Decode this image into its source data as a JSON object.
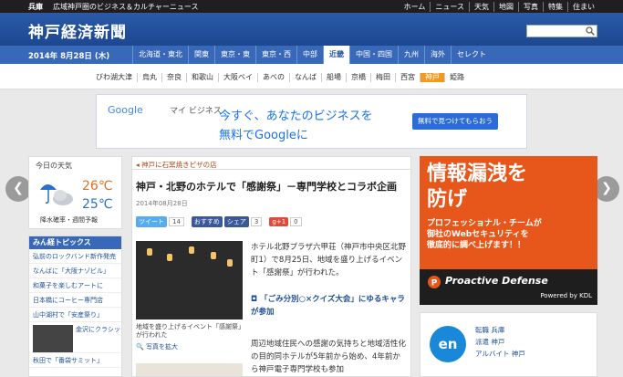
{
  "topbar": {
    "tag": "兵庫",
    "subtitle": "広域神戸圏のビジネス＆カルチャーニュース",
    "nav": [
      "ホーム",
      "ニュース",
      "天気",
      "地図",
      "写真",
      "特集",
      "住まい"
    ]
  },
  "header": {
    "logo": "神戸経済新聞",
    "search_placeholder": ""
  },
  "regionbar": {
    "date": "2014年 8月28日",
    "weekday": "(木)",
    "regions": [
      "北海道・東北",
      "関東",
      "東京・東",
      "東京・西",
      "中部",
      "近畿",
      "中国・四国",
      "九州",
      "海外",
      "セレクト"
    ],
    "active": "近畿"
  },
  "subnav": {
    "items": [
      "びわ湖大津",
      "烏丸",
      "奈良",
      "和歌山",
      "大阪ベイ",
      "あべの",
      "なんば",
      "船場",
      "京橋",
      "梅田",
      "西宮",
      "神戸",
      "姫路"
    ],
    "active": "神戸"
  },
  "ad": {
    "google": "Google",
    "mybusiness": "マイ ビジネス",
    "line1": "今すぐ、あなたのビジネスを",
    "line2": "無料でGoogleに",
    "cta": "無料で見つけてもらおう"
  },
  "weather": {
    "title": "今日の天気",
    "high": "26℃",
    "low": "25℃",
    "note": "降水確率・週間予報"
  },
  "topics": {
    "title": "みん経トピックス",
    "items": [
      "弘前のロックバンド新作発売",
      "なんばに「大阪ナゾビル」",
      "和菓子を楽しむアートに",
      "日本橋にコーヒー専門店",
      "山中湖村で「安産祭り」",
      "金沢にクラシックのカフェ",
      "秋田で「番袋サミット」"
    ]
  },
  "article": {
    "crumb": "神戸に石窯焼きピザの店",
    "title": "神戸・北野のホテルで「感謝祭」－専門学校とコラボ企画",
    "date": "2014年08月28日",
    "tweet": "ツイート",
    "tweet_count": "14",
    "like": "おすすめ",
    "share": "シェア",
    "share_count": "3",
    "gplus": "g+1",
    "gplus_count": "0",
    "photo_caption": "地域を盛り上げるイベント「感謝祭」が行われた",
    "photo_enlarge": "写真を拡大",
    "body1": "ホテル北野プラザ六甲荘（神戸市中央区北野町1）で8月25日、地域を盛り上げるイベント「感謝祭」が行われた。",
    "related": "「ごみ分別○×クイズ大会」にゆるキャラが参加",
    "body2": "周辺地域住民への感謝の気持ちと地域活性化の目的同ホテルが5年前から始め、4年前から神戸電子専門学校も参加"
  },
  "banner": {
    "headline1": "情報漏洩を",
    "headline2": "防げ",
    "desc1": "プロフェッショナル・チームが",
    "desc2": "御社のWebセキュリティを",
    "desc3": "徹底的に調べ上げます！！",
    "brand": "Proactive Defense",
    "by": "Powered by KDL"
  },
  "jobs": {
    "logo": "en",
    "links": [
      "転職 兵庫",
      "派遣 神戸",
      "アルバイト 神戸"
    ]
  },
  "colors": {
    "brand_blue": "#2a5aa8",
    "accent_orange": "#f29a1d",
    "banner_orange": "#e7561a"
  }
}
